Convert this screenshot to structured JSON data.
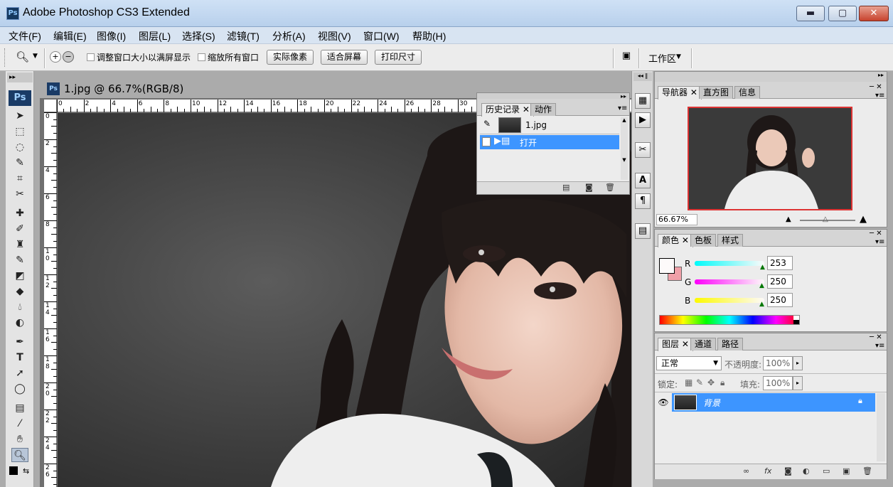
{
  "window": {
    "title": "Adobe Photoshop CS3 Extended",
    "app_icon": "Ps",
    "minimize_label": "▬",
    "maximize_label": "▢",
    "close_label": "✕"
  },
  "menu": [
    "文件(F)",
    "编辑(E)",
    "图像(I)",
    "图层(L)",
    "选择(S)",
    "滤镜(T)",
    "分析(A)",
    "视图(V)",
    "窗口(W)",
    "帮助(H)"
  ],
  "options_bar": {
    "checkbox_resize": "调整窗口大小以满屏显示",
    "checkbox_zoom_all": "缩放所有窗口",
    "btn_actual": "实际像素",
    "btn_fit": "适合屏幕",
    "btn_print": "打印尺寸",
    "workspace": "工作区"
  },
  "toolbox": {
    "logo": "Ps"
  },
  "document": {
    "tab_title": "1.jpg @ 66.7%(RGB/8)",
    "tab_icon": "Ps",
    "ruler_h_ticks": [
      "0",
      "2",
      "4",
      "6",
      "8",
      "10",
      "12",
      "14",
      "16",
      "18",
      "20",
      "22",
      "24",
      "26",
      "28",
      "30"
    ],
    "ruler_v_ticks": [
      "0",
      "2",
      "4",
      "6",
      "8",
      "10",
      "12",
      "14",
      "16",
      "18",
      "20",
      "22",
      "24",
      "26"
    ]
  },
  "history_panel": {
    "tabs": [
      "历史记录",
      "动作"
    ],
    "snapshot": "1.jpg",
    "states": [
      "打开"
    ]
  },
  "navigator_panel": {
    "tabs": [
      "导航器",
      "直方图",
      "信息"
    ],
    "zoom": "66.67%"
  },
  "color_panel": {
    "tabs": [
      "颜色",
      "色板",
      "样式"
    ],
    "channels": [
      {
        "label": "R",
        "value": "253",
        "fraction": 0.99
      },
      {
        "label": "G",
        "value": "250",
        "fraction": 0.98
      },
      {
        "label": "B",
        "value": "250",
        "fraction": 0.98
      }
    ],
    "foreground": "#fdfafa",
    "background": "#f0a0a8"
  },
  "layers_panel": {
    "tabs": [
      "图层",
      "通道",
      "路径"
    ],
    "blend_mode": "正常",
    "opacity_label": "不透明度:",
    "opacity_value": "100%",
    "lock_label": "锁定:",
    "fill_label": "填充:",
    "fill_value": "100%",
    "layers": [
      {
        "name": "背景",
        "locked": true,
        "visible": true
      }
    ]
  },
  "colors": {
    "selection_blue": "#3d95ff",
    "title_gradient_top": "#cfe1f5",
    "menu_bg": "#d8e4f2"
  }
}
